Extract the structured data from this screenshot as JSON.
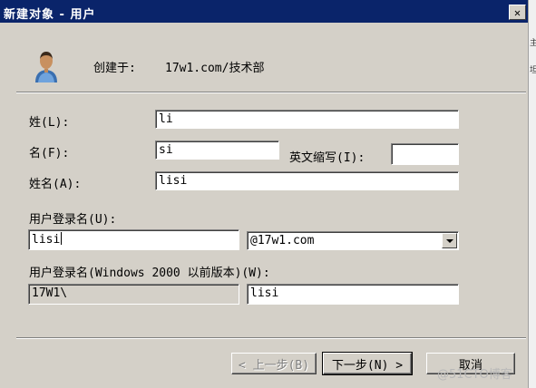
{
  "window": {
    "title": "新建对象 - 用户",
    "close_glyph": "✕"
  },
  "header": {
    "created_in_label": "创建于:",
    "created_in_path": "17w1.com/技术部",
    "icon": "user-icon"
  },
  "form": {
    "last_name_label": "姓(L):",
    "last_name_value": "li",
    "first_name_label": "名(F):",
    "first_name_value": "si",
    "initials_label": "英文缩写(I):",
    "initials_value": "",
    "full_name_label": "姓名(A):",
    "full_name_value": "lisi",
    "logon_name_label": "用户登录名(U):",
    "logon_name_value": "lisi",
    "domain_suffix_value": "@17w1.com",
    "pre2000_label": "用户登录名(Windows 2000 以前版本)(W):",
    "pre2000_domain_value": "17W1\\",
    "pre2000_name_value": "lisi"
  },
  "buttons": {
    "back_label": "< 上一步(B)",
    "next_label": "下一步(N) >",
    "cancel_label": "取消"
  },
  "watermark": "@51CTO博客",
  "right_strip": {
    "text_1": "主",
    "text_2": "坦"
  },
  "colors": {
    "titlebar": "#0a246a",
    "dialog_bg": "#d4d0c8"
  }
}
